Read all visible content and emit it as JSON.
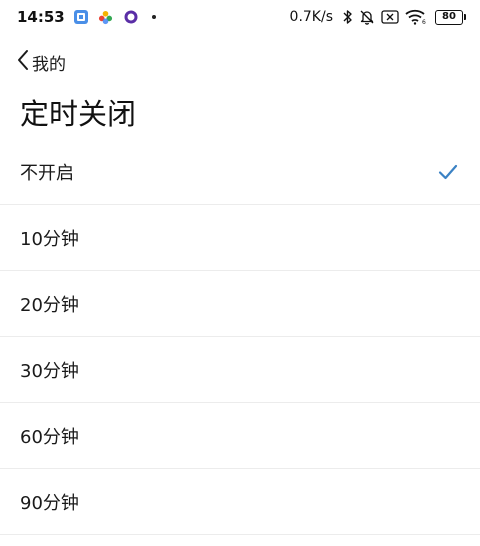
{
  "status_bar": {
    "time": "14:53",
    "net_speed": "0.7K/s",
    "battery": "80"
  },
  "header": {
    "back_label": "我的",
    "title": "定时关闭"
  },
  "options": [
    {
      "label": "不开启",
      "selected": true
    },
    {
      "label": "10分钟",
      "selected": false
    },
    {
      "label": "20分钟",
      "selected": false
    },
    {
      "label": "30分钟",
      "selected": false
    },
    {
      "label": "60分钟",
      "selected": false
    },
    {
      "label": "90分钟",
      "selected": false
    }
  ],
  "colors": {
    "accent": "#3b82c4",
    "divider": "#ececec",
    "text": "#1a1a1a"
  },
  "icons": {
    "back": "chevron-left-icon",
    "selected": "check-icon"
  }
}
